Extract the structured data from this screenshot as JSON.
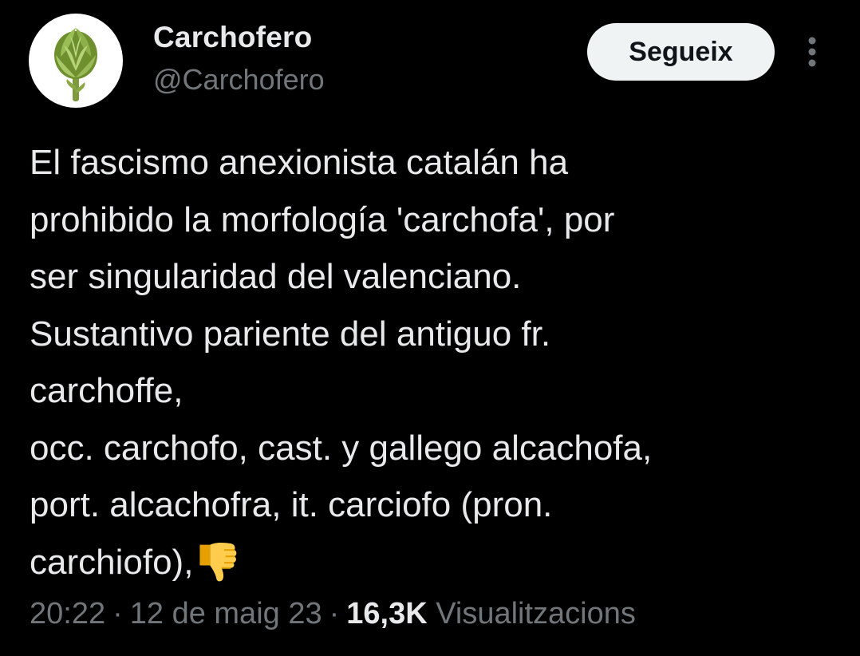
{
  "author": {
    "display_name": "Carchofero",
    "handle": "@Carchofero",
    "avatar_icon": "artichoke-icon"
  },
  "follow_button": {
    "label": "Segueix"
  },
  "more_button": {
    "icon": "more-vertical-icon"
  },
  "tweet": {
    "text": "El fascismo anexionista catalán ha\nprohibido la morfología 'carchofa', por\nser singularidad del valenciano.\nSustantivo pariente del antiguo fr.\ncarchoffe,\nocc. carchofo, cast. y gallego alcachofa,\nport. alcachofra, it. carciofo (pron.\ncarchiofo),",
    "trailing_emoji": "thumbs-down-icon"
  },
  "meta": {
    "time": "20:22",
    "date": "12 de maig 23",
    "separator": "·",
    "views_count": "16,3K",
    "views_label": "Visualitzacions"
  },
  "colors": {
    "background": "#000000",
    "primary_text": "#e7e9ea",
    "secondary_text": "#71767b",
    "follow_button_bg": "#eff3f4",
    "follow_button_text": "#0f1419"
  }
}
